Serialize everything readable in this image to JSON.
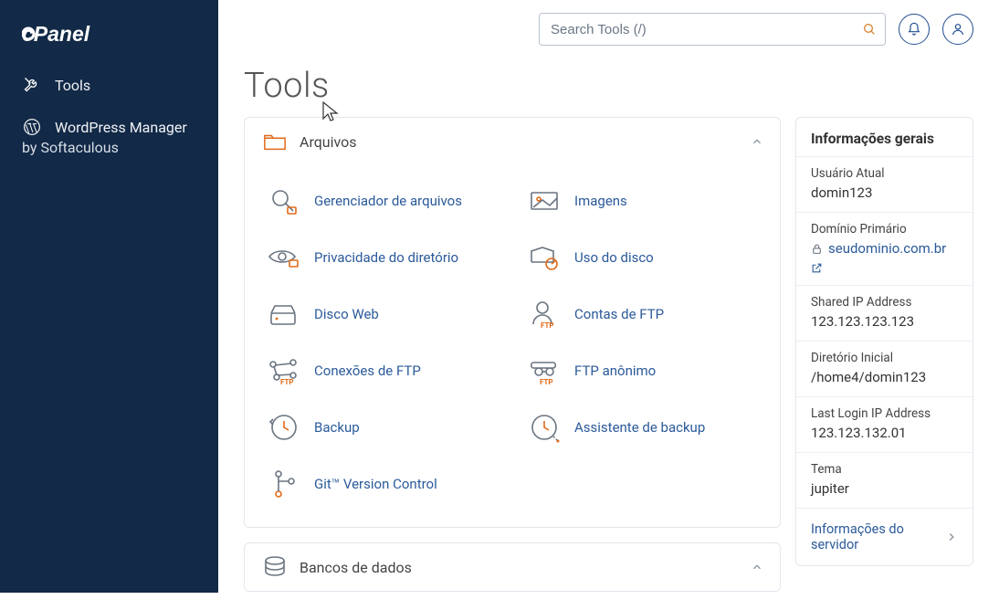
{
  "brand": "cPanel",
  "search": {
    "placeholder": "Search Tools (/)"
  },
  "sidebar": {
    "items": [
      {
        "label": "Tools"
      },
      {
        "label": "WordPress Manager"
      }
    ],
    "subline": "by Softaculous"
  },
  "page": {
    "title": "Tools"
  },
  "sections": {
    "files": {
      "title": "Arquivos",
      "items": [
        {
          "id": "file-manager",
          "label": "Gerenciador de arquivos"
        },
        {
          "id": "images",
          "label": "Imagens"
        },
        {
          "id": "dir-privacy",
          "label": "Privacidade do diretório"
        },
        {
          "id": "disk-usage",
          "label": "Uso do disco"
        },
        {
          "id": "web-disk",
          "label": "Disco Web"
        },
        {
          "id": "ftp-accounts",
          "label": "Contas de FTP"
        },
        {
          "id": "ftp-connections",
          "label": "Conexões de FTP"
        },
        {
          "id": "anon-ftp",
          "label": "FTP anônimo"
        },
        {
          "id": "backup",
          "label": "Backup"
        },
        {
          "id": "backup-wizard",
          "label": "Assistente de backup"
        },
        {
          "id": "git",
          "label": "Git™ Version Control"
        }
      ]
    },
    "databases": {
      "title": "Bancos de dados"
    }
  },
  "info": {
    "title": "Informações gerais",
    "current_user_label": "Usuário Atual",
    "current_user_value": "domin123",
    "primary_domain_label": "Domínio Primário",
    "primary_domain_value": "seudominio.com.br",
    "shared_ip_label": "Shared IP Address",
    "shared_ip_value": "123.123.123.123",
    "home_dir_label": "Diretório Inicial",
    "home_dir_value": "/home4/domin123",
    "last_login_label": "Last Login IP Address",
    "last_login_value": "123.123.132.01",
    "theme_label": "Tema",
    "theme_value": "jupiter",
    "server_info_label": "Informações do servidor"
  }
}
